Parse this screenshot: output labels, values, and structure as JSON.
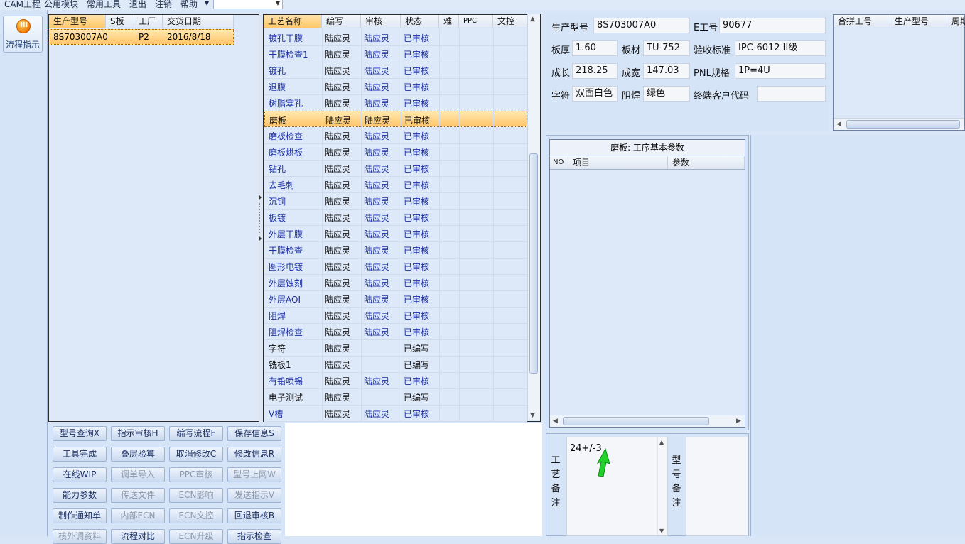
{
  "menu": {
    "items": [
      "CAM工程",
      "公用模块",
      "常用工具",
      "退出",
      "注销",
      "帮助"
    ],
    "combo_value": ""
  },
  "flow_button": {
    "label": "流程指示",
    "icon": "flow-indicator-icon"
  },
  "order_grid": {
    "columns": [
      "生产型号",
      "S板",
      "工厂",
      "交货日期"
    ],
    "rows": [
      {
        "model": "8S703007A0",
        "s": "",
        "factory": "P2",
        "date": "2016/8/18"
      }
    ]
  },
  "process_grid": {
    "columns": [
      "工艺名称",
      "编写",
      "审核",
      "状态",
      "难",
      "PPC",
      "文控"
    ],
    "selected_index": 5,
    "rows": [
      {
        "name": "镀孔干膜",
        "writer": "陆应灵",
        "reviewer": "陆应灵",
        "status": "已审核"
      },
      {
        "name": "干膜检查1",
        "writer": "陆应灵",
        "reviewer": "陆应灵",
        "status": "已审核"
      },
      {
        "name": "镀孔",
        "writer": "陆应灵",
        "reviewer": "陆应灵",
        "status": "已审核"
      },
      {
        "name": "退膜",
        "writer": "陆应灵",
        "reviewer": "陆应灵",
        "status": "已审核"
      },
      {
        "name": "树脂塞孔",
        "writer": "陆应灵",
        "reviewer": "陆应灵",
        "status": "已审核"
      },
      {
        "name": "磨板",
        "writer": "陆应灵",
        "reviewer": "陆应灵",
        "status": "已审核"
      },
      {
        "name": "磨板检查",
        "writer": "陆应灵",
        "reviewer": "陆应灵",
        "status": "已审核"
      },
      {
        "name": "磨板烘板",
        "writer": "陆应灵",
        "reviewer": "陆应灵",
        "status": "已审核"
      },
      {
        "name": "钻孔",
        "writer": "陆应灵",
        "reviewer": "陆应灵",
        "status": "已审核"
      },
      {
        "name": "去毛刺",
        "writer": "陆应灵",
        "reviewer": "陆应灵",
        "status": "已审核"
      },
      {
        "name": "沉铜",
        "writer": "陆应灵",
        "reviewer": "陆应灵",
        "status": "已审核"
      },
      {
        "name": "板镀",
        "writer": "陆应灵",
        "reviewer": "陆应灵",
        "status": "已审核"
      },
      {
        "name": "外层干膜",
        "writer": "陆应灵",
        "reviewer": "陆应灵",
        "status": "已审核"
      },
      {
        "name": "干膜检查",
        "writer": "陆应灵",
        "reviewer": "陆应灵",
        "status": "已审核"
      },
      {
        "name": "图形电镀",
        "writer": "陆应灵",
        "reviewer": "陆应灵",
        "status": "已审核"
      },
      {
        "name": "外层蚀刻",
        "writer": "陆应灵",
        "reviewer": "陆应灵",
        "status": "已审核"
      },
      {
        "name": "外层AOI",
        "writer": "陆应灵",
        "reviewer": "陆应灵",
        "status": "已审核"
      },
      {
        "name": "阻焊",
        "writer": "陆应灵",
        "reviewer": "陆应灵",
        "status": "已审核"
      },
      {
        "name": "阻焊检查",
        "writer": "陆应灵",
        "reviewer": "陆应灵",
        "status": "已审核"
      },
      {
        "name": "字符",
        "writer": "陆应灵",
        "reviewer": "",
        "status": "已编写"
      },
      {
        "name": "铣板1",
        "writer": "陆应灵",
        "reviewer": "",
        "status": "已编写"
      },
      {
        "name": "有铅喷锡",
        "writer": "陆应灵",
        "reviewer": "陆应灵",
        "status": "已审核"
      },
      {
        "name": "电子测试",
        "writer": "陆应灵",
        "reviewer": "",
        "status": "已编写"
      },
      {
        "name": "V槽",
        "writer": "陆应灵",
        "reviewer": "陆应灵",
        "status": "已审核"
      }
    ]
  },
  "buttons": [
    {
      "label": "型号查询X",
      "enabled": true
    },
    {
      "label": "指示审核H",
      "enabled": true
    },
    {
      "label": "编写流程F",
      "enabled": true
    },
    {
      "label": "保存信息S",
      "enabled": true
    },
    {
      "label": "工具完成",
      "enabled": true
    },
    {
      "label": "叠层验算",
      "enabled": true
    },
    {
      "label": "取消修改C",
      "enabled": true
    },
    {
      "label": "修改信息R",
      "enabled": true
    },
    {
      "label": "在线WIP",
      "enabled": true
    },
    {
      "label": "调单导入",
      "enabled": false
    },
    {
      "label": "PPC审核",
      "enabled": false
    },
    {
      "label": "型号上网W",
      "enabled": false
    },
    {
      "label": "能力参数",
      "enabled": true
    },
    {
      "label": "传送文件",
      "enabled": false
    },
    {
      "label": "ECN影响",
      "enabled": false
    },
    {
      "label": "发送指示V",
      "enabled": false
    },
    {
      "label": "制作通知单",
      "enabled": true
    },
    {
      "label": "内部ECN",
      "enabled": false
    },
    {
      "label": "ECN文控",
      "enabled": false
    },
    {
      "label": "回退审核B",
      "enabled": true
    },
    {
      "label": "核外调资料",
      "enabled": false
    },
    {
      "label": "流程对比",
      "enabled": true
    },
    {
      "label": "ECN升级",
      "enabled": false
    },
    {
      "label": "指示检查",
      "enabled": true
    }
  ],
  "info": {
    "model_label": "生产型号",
    "model_value": "8S703007A0",
    "eno_label": "E工号",
    "eno_value": "90677",
    "thickness_label": "板厚",
    "thickness_value": "1.60",
    "material_label": "板材",
    "material_value": "TU-752",
    "standard_label": "验收标准",
    "standard_value": "IPC-6012 II级",
    "length_label": "成长",
    "length_value": "218.25",
    "width_label": "成宽",
    "width_value": "147.03",
    "pnl_label": "PNL规格",
    "pnl_value": "1P=4U",
    "char_label": "字符",
    "char_value": "双面白色",
    "mask_label": "阻焊",
    "mask_value": "绿色",
    "customer_label": "终端客户代码",
    "customer_value": ""
  },
  "merge_grid": {
    "columns": [
      "合拼工号",
      "生产型号",
      "周期"
    ]
  },
  "params": {
    "title": "磨板: 工序基本参数",
    "columns": [
      "NO",
      "项目",
      "参数"
    ]
  },
  "remarks": {
    "process_label": "工艺备注",
    "process_value": "24+/-3",
    "model_label": "型号备注",
    "model_value": ""
  },
  "colors": {
    "selected_row": "#ffc56a",
    "approved_text": "#1a2fa6",
    "background": "#d9e6f7"
  }
}
